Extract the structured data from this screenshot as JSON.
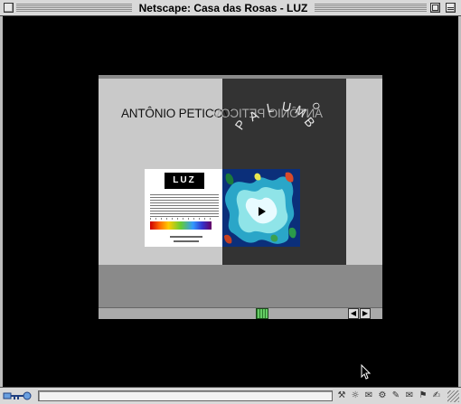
{
  "window": {
    "title": "Netscape: Casa das Rosas - LUZ"
  },
  "movie": {
    "artist_name": "ANTÔNIO PETICOV",
    "artist_mirror": "ANTÔNIO PETICOV",
    "arc_letters": [
      "P",
      "A",
      "L",
      "U",
      "M",
      "B",
      "O"
    ],
    "card_title": "LUZ"
  },
  "colors": {
    "window_chrome": "#d9d9d9",
    "page_background": "#000000",
    "panel_light": "#c9c9c9",
    "panel_dark": "#333333",
    "scroll_thumb": "#66cc66"
  },
  "icons": {
    "close": "close-icon",
    "zoom": "zoom-icon",
    "collapse": "collapse-icon",
    "security": "security-key-icon",
    "scroll_left": "arrow-left-icon",
    "scroll_right": "arrow-right-icon",
    "cursor": "mouse-pointer-icon"
  },
  "scroll": {
    "left_arrow": "◀",
    "right_arrow": "▶"
  },
  "status_icons": [
    "⚒",
    "☼",
    "✉",
    "⚙",
    "✎",
    "✉",
    "⚑",
    "✍"
  ]
}
